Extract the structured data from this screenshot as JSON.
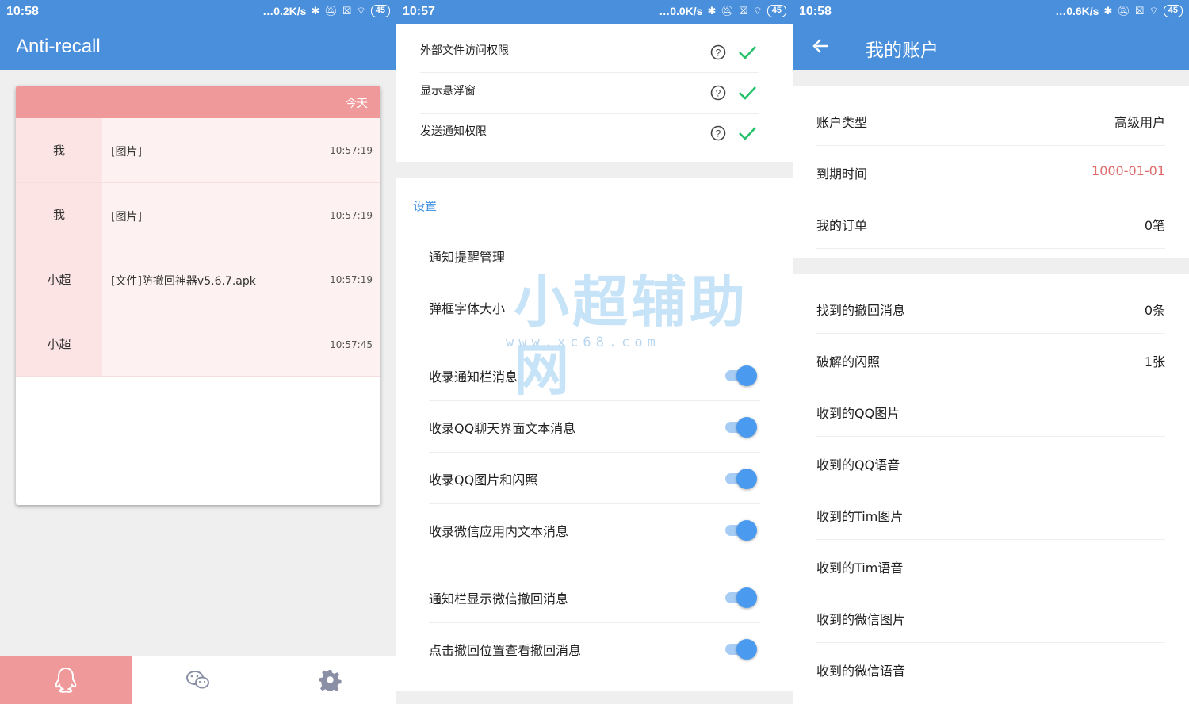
{
  "screens": [
    {
      "status": {
        "time": "10:58",
        "speed": "0.2K/s",
        "battery": "45"
      },
      "appbar": {
        "title": "Anti-recall"
      },
      "card": {
        "header_label": "今天",
        "messages": [
          {
            "sender": "我",
            "text": "[图片]",
            "time": "10:57:19"
          },
          {
            "sender": "我",
            "text": "[图片]",
            "time": "10:57:19"
          },
          {
            "sender": "小超",
            "text": "[文件]防撤回神器v5.6.7.apk",
            "time": "10:57:19"
          },
          {
            "sender": "小超",
            "text": "",
            "time": "10:57:45"
          }
        ]
      },
      "bottom_nav": [
        {
          "icon": "qq-penguin-icon",
          "active": true
        },
        {
          "icon": "wechat-icon",
          "active": false
        },
        {
          "icon": "gear-icon",
          "active": false
        }
      ],
      "colors": {
        "accent": "#4a8fdc",
        "pink": "#f0999a"
      }
    },
    {
      "status": {
        "time": "10:57",
        "speed": "0.0K/s",
        "battery": "45"
      },
      "permissions": [
        {
          "label": "外部文件访问权限",
          "granted": true
        },
        {
          "label": "显示悬浮窗",
          "granted": true
        },
        {
          "label": "发送通知权限",
          "granted": true
        }
      ],
      "section_title": "设置",
      "settings": [
        {
          "label": "通知提醒管理",
          "toggle": false
        },
        {
          "label": "弹框字体大小",
          "toggle": false
        },
        {
          "label": "收录通知栏消息",
          "toggle": true
        },
        {
          "label": "收录QQ聊天界面文本消息",
          "toggle": true
        },
        {
          "label": "收录QQ图片和闪照",
          "toggle": true
        },
        {
          "label": "收录微信应用内文本消息",
          "toggle": true
        },
        {
          "label": "通知栏显示微信撤回消息",
          "toggle": true
        },
        {
          "label": "点击撤回位置查看撤回消息",
          "toggle": true
        }
      ],
      "watermark": {
        "main": "小超辅助网",
        "sub": "www.xc68.com"
      }
    },
    {
      "status": {
        "time": "10:58",
        "speed": "0.6K/s",
        "battery": "45"
      },
      "appbar": {
        "title": "我的账户"
      },
      "account": [
        {
          "label": "账户类型",
          "value": "高级用户"
        },
        {
          "label": "到期时间",
          "value": "1000-01-01",
          "highlight": true
        },
        {
          "label": "我的订单",
          "value": "0笔"
        }
      ],
      "stats": [
        {
          "label": "找到的撤回消息",
          "value": "0条"
        },
        {
          "label": "破解的闪照",
          "value": "1张"
        },
        {
          "label": "收到的QQ图片",
          "value": ""
        },
        {
          "label": "收到的QQ语音",
          "value": ""
        },
        {
          "label": "收到的Tim图片",
          "value": ""
        },
        {
          "label": "收到的Tim语音",
          "value": ""
        },
        {
          "label": "收到的微信图片",
          "value": ""
        },
        {
          "label": "收到的微信语音",
          "value": ""
        }
      ]
    }
  ]
}
